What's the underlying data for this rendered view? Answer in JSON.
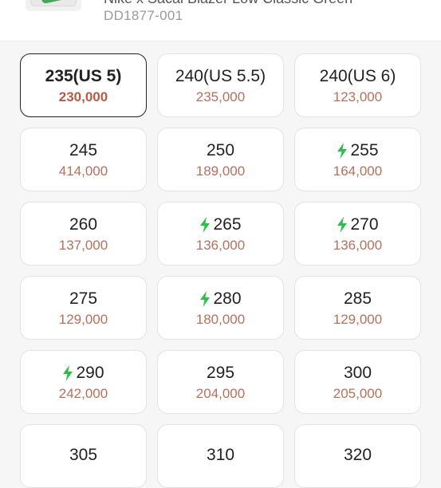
{
  "header": {
    "product_name": "Nike x Sacai Blazer Low Classic Green",
    "product_code": "DD1877-001"
  },
  "sizes": [
    {
      "size": "235(US 5)",
      "price": "230,000",
      "fast": false,
      "selected": true
    },
    {
      "size": "240(US 5.5)",
      "price": "235,000",
      "fast": false,
      "selected": false
    },
    {
      "size": "240(US 6)",
      "price": "123,000",
      "fast": false,
      "selected": false
    },
    {
      "size": "245",
      "price": "414,000",
      "fast": false,
      "selected": false
    },
    {
      "size": "250",
      "price": "189,000",
      "fast": false,
      "selected": false
    },
    {
      "size": "255",
      "price": "164,000",
      "fast": true,
      "selected": false
    },
    {
      "size": "260",
      "price": "137,000",
      "fast": false,
      "selected": false
    },
    {
      "size": "265",
      "price": "136,000",
      "fast": true,
      "selected": false
    },
    {
      "size": "270",
      "price": "136,000",
      "fast": true,
      "selected": false
    },
    {
      "size": "275",
      "price": "129,000",
      "fast": false,
      "selected": false
    },
    {
      "size": "280",
      "price": "180,000",
      "fast": true,
      "selected": false
    },
    {
      "size": "285",
      "price": "129,000",
      "fast": false,
      "selected": false
    },
    {
      "size": "290",
      "price": "242,000",
      "fast": true,
      "selected": false
    },
    {
      "size": "295",
      "price": "204,000",
      "fast": false,
      "selected": false
    },
    {
      "size": "300",
      "price": "205,000",
      "fast": false,
      "selected": false
    },
    {
      "size": "305",
      "price": "",
      "fast": false,
      "selected": false
    },
    {
      "size": "310",
      "price": "",
      "fast": false,
      "selected": false
    },
    {
      "size": "320",
      "price": "",
      "fast": false,
      "selected": false
    }
  ],
  "icons": {
    "fast_delivery": "lightning-bolt-icon",
    "bolt_color": "#2fbe4a"
  },
  "colors": {
    "price": "#b5705e",
    "selected_border": "#222222"
  }
}
